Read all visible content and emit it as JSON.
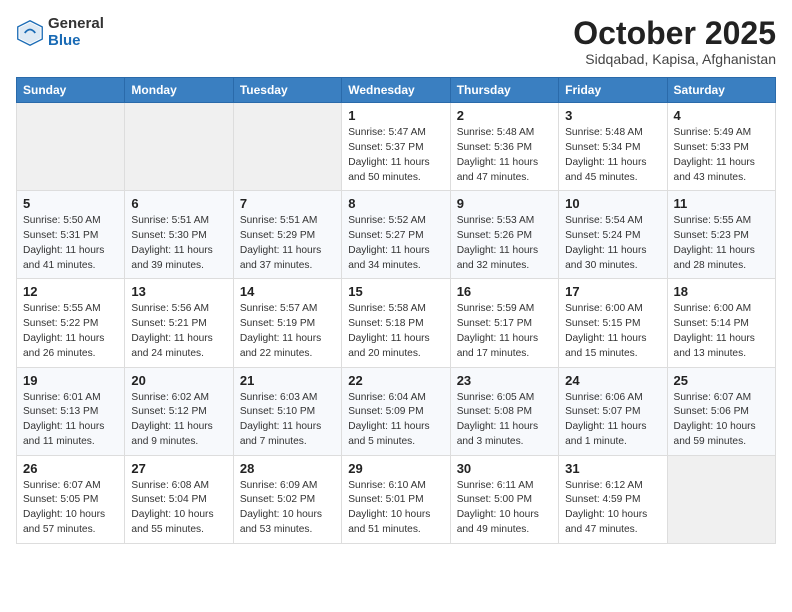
{
  "logo": {
    "general": "General",
    "blue": "Blue"
  },
  "title": "October 2025",
  "subtitle": "Sidqabad, Kapisa, Afghanistan",
  "weekdays": [
    "Sunday",
    "Monday",
    "Tuesday",
    "Wednesday",
    "Thursday",
    "Friday",
    "Saturday"
  ],
  "weeks": [
    [
      {
        "day": "",
        "info": ""
      },
      {
        "day": "",
        "info": ""
      },
      {
        "day": "",
        "info": ""
      },
      {
        "day": "1",
        "info": "Sunrise: 5:47 AM\nSunset: 5:37 PM\nDaylight: 11 hours\nand 50 minutes."
      },
      {
        "day": "2",
        "info": "Sunrise: 5:48 AM\nSunset: 5:36 PM\nDaylight: 11 hours\nand 47 minutes."
      },
      {
        "day": "3",
        "info": "Sunrise: 5:48 AM\nSunset: 5:34 PM\nDaylight: 11 hours\nand 45 minutes."
      },
      {
        "day": "4",
        "info": "Sunrise: 5:49 AM\nSunset: 5:33 PM\nDaylight: 11 hours\nand 43 minutes."
      }
    ],
    [
      {
        "day": "5",
        "info": "Sunrise: 5:50 AM\nSunset: 5:31 PM\nDaylight: 11 hours\nand 41 minutes."
      },
      {
        "day": "6",
        "info": "Sunrise: 5:51 AM\nSunset: 5:30 PM\nDaylight: 11 hours\nand 39 minutes."
      },
      {
        "day": "7",
        "info": "Sunrise: 5:51 AM\nSunset: 5:29 PM\nDaylight: 11 hours\nand 37 minutes."
      },
      {
        "day": "8",
        "info": "Sunrise: 5:52 AM\nSunset: 5:27 PM\nDaylight: 11 hours\nand 34 minutes."
      },
      {
        "day": "9",
        "info": "Sunrise: 5:53 AM\nSunset: 5:26 PM\nDaylight: 11 hours\nand 32 minutes."
      },
      {
        "day": "10",
        "info": "Sunrise: 5:54 AM\nSunset: 5:24 PM\nDaylight: 11 hours\nand 30 minutes."
      },
      {
        "day": "11",
        "info": "Sunrise: 5:55 AM\nSunset: 5:23 PM\nDaylight: 11 hours\nand 28 minutes."
      }
    ],
    [
      {
        "day": "12",
        "info": "Sunrise: 5:55 AM\nSunset: 5:22 PM\nDaylight: 11 hours\nand 26 minutes."
      },
      {
        "day": "13",
        "info": "Sunrise: 5:56 AM\nSunset: 5:21 PM\nDaylight: 11 hours\nand 24 minutes."
      },
      {
        "day": "14",
        "info": "Sunrise: 5:57 AM\nSunset: 5:19 PM\nDaylight: 11 hours\nand 22 minutes."
      },
      {
        "day": "15",
        "info": "Sunrise: 5:58 AM\nSunset: 5:18 PM\nDaylight: 11 hours\nand 20 minutes."
      },
      {
        "day": "16",
        "info": "Sunrise: 5:59 AM\nSunset: 5:17 PM\nDaylight: 11 hours\nand 17 minutes."
      },
      {
        "day": "17",
        "info": "Sunrise: 6:00 AM\nSunset: 5:15 PM\nDaylight: 11 hours\nand 15 minutes."
      },
      {
        "day": "18",
        "info": "Sunrise: 6:00 AM\nSunset: 5:14 PM\nDaylight: 11 hours\nand 13 minutes."
      }
    ],
    [
      {
        "day": "19",
        "info": "Sunrise: 6:01 AM\nSunset: 5:13 PM\nDaylight: 11 hours\nand 11 minutes."
      },
      {
        "day": "20",
        "info": "Sunrise: 6:02 AM\nSunset: 5:12 PM\nDaylight: 11 hours\nand 9 minutes."
      },
      {
        "day": "21",
        "info": "Sunrise: 6:03 AM\nSunset: 5:10 PM\nDaylight: 11 hours\nand 7 minutes."
      },
      {
        "day": "22",
        "info": "Sunrise: 6:04 AM\nSunset: 5:09 PM\nDaylight: 11 hours\nand 5 minutes."
      },
      {
        "day": "23",
        "info": "Sunrise: 6:05 AM\nSunset: 5:08 PM\nDaylight: 11 hours\nand 3 minutes."
      },
      {
        "day": "24",
        "info": "Sunrise: 6:06 AM\nSunset: 5:07 PM\nDaylight: 11 hours\nand 1 minute."
      },
      {
        "day": "25",
        "info": "Sunrise: 6:07 AM\nSunset: 5:06 PM\nDaylight: 10 hours\nand 59 minutes."
      }
    ],
    [
      {
        "day": "26",
        "info": "Sunrise: 6:07 AM\nSunset: 5:05 PM\nDaylight: 10 hours\nand 57 minutes."
      },
      {
        "day": "27",
        "info": "Sunrise: 6:08 AM\nSunset: 5:04 PM\nDaylight: 10 hours\nand 55 minutes."
      },
      {
        "day": "28",
        "info": "Sunrise: 6:09 AM\nSunset: 5:02 PM\nDaylight: 10 hours\nand 53 minutes."
      },
      {
        "day": "29",
        "info": "Sunrise: 6:10 AM\nSunset: 5:01 PM\nDaylight: 10 hours\nand 51 minutes."
      },
      {
        "day": "30",
        "info": "Sunrise: 6:11 AM\nSunset: 5:00 PM\nDaylight: 10 hours\nand 49 minutes."
      },
      {
        "day": "31",
        "info": "Sunrise: 6:12 AM\nSunset: 4:59 PM\nDaylight: 10 hours\nand 47 minutes."
      },
      {
        "day": "",
        "info": ""
      }
    ]
  ]
}
